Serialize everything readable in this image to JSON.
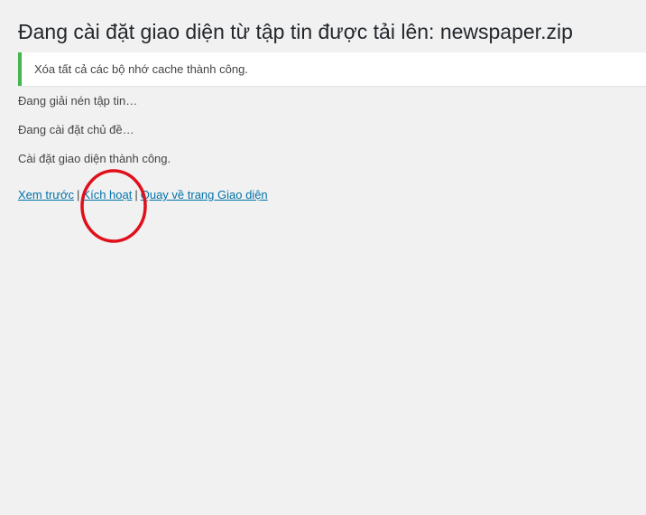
{
  "page_title": "Đang cài đặt giao diện từ tập tin được tải lên: newspaper.zip",
  "notice": {
    "text": "Xóa tất cả các bộ nhớ cache thành công.",
    "accent_color": "#46b450"
  },
  "messages": [
    "Đang giải nén tập tin…",
    "Đang cài đặt chủ đề…",
    "Cài đặt giao diện thành công."
  ],
  "actions": {
    "preview": "Xem trước",
    "activate": "Kích hoạt",
    "back_to_themes": "Quay về trang Giao diện",
    "separator": "|"
  },
  "annotation": {
    "shape": "circle",
    "color": "#e0101b",
    "highlights": "activate"
  },
  "colors": {
    "link": "#0073aa",
    "background": "#f1f1f1"
  }
}
